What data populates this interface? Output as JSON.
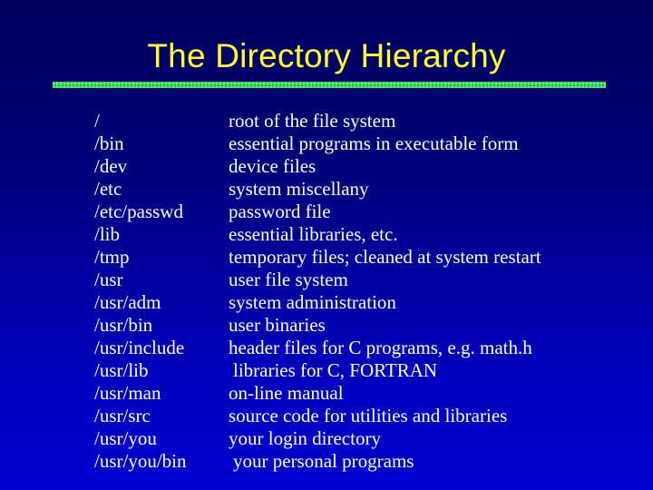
{
  "slide": {
    "title": "The Directory Hierarchy",
    "title_color": "#FFFF33",
    "rule_color": "#00CC33",
    "background_top_color": "#000060",
    "background_bottom_color": "#0000CE",
    "text_color": "#FFFFFF"
  },
  "table": {
    "rows": [
      {
        "path": "/",
        "description": "root of the file system",
        "indented": false
      },
      {
        "path": "/bin",
        "description": "essential programs in executable form",
        "indented": false
      },
      {
        "path": "/dev",
        "description": "device files",
        "indented": false
      },
      {
        "path": "/etc",
        "description": "system miscellany",
        "indented": false
      },
      {
        "path": "/etc/passwd",
        "description": "password file",
        "indented": false
      },
      {
        "path": "/lib",
        "description": "essential libraries, etc.",
        "indented": false
      },
      {
        "path": "/tmp",
        "description": "temporary files; cleaned at system restart",
        "indented": false
      },
      {
        "path": "/usr",
        "description": "user file system",
        "indented": false
      },
      {
        "path": "/usr/adm",
        "description": "system administration",
        "indented": false
      },
      {
        "path": "/usr/bin",
        "description": "user binaries",
        "indented": false
      },
      {
        "path": "/usr/include",
        "description": "header files for C programs, e.g. math.h",
        "indented": false
      },
      {
        "path": "/usr/lib",
        "description": "libraries for C, FORTRAN",
        "indented": true
      },
      {
        "path": "/usr/man",
        "description": "on-line manual",
        "indented": false
      },
      {
        "path": "/usr/src",
        "description": "source code for utilities and libraries",
        "indented": false
      },
      {
        "path": "/usr/you",
        "description": "your login directory",
        "indented": false
      },
      {
        "path": "/usr/you/bin",
        "description": "your personal programs",
        "indented": true
      }
    ]
  }
}
